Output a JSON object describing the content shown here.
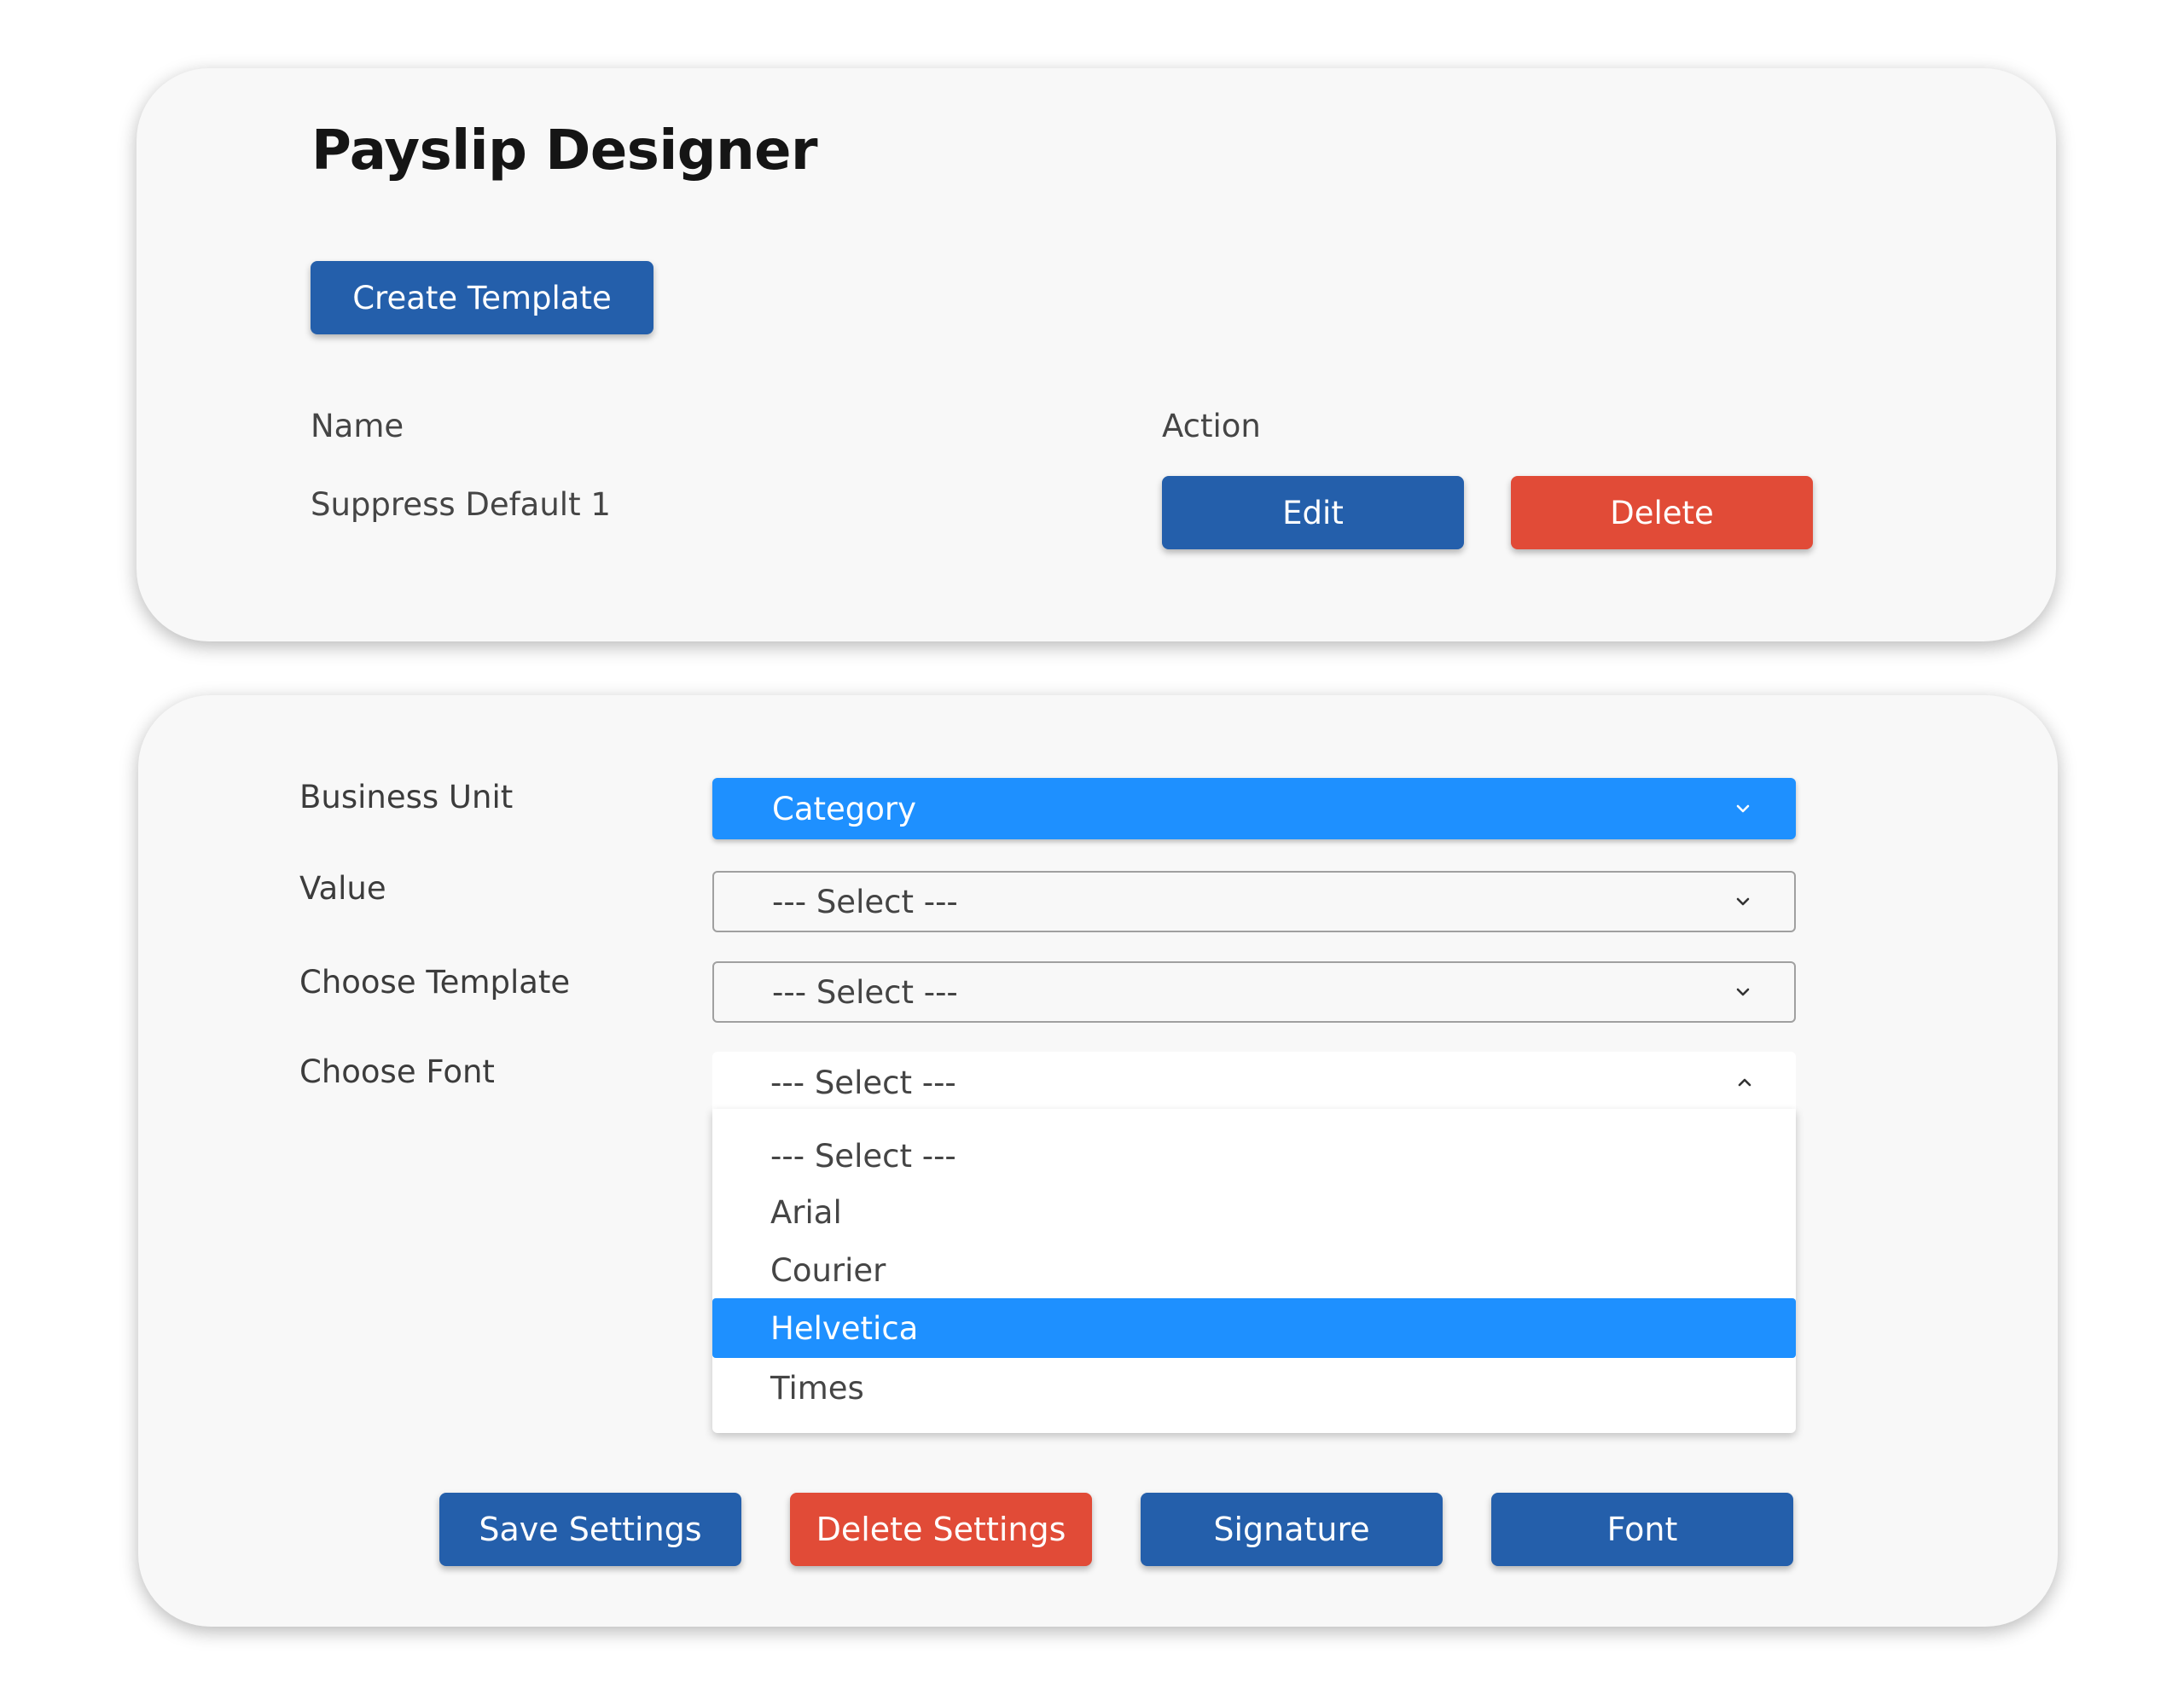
{
  "header": {
    "title": "Payslip Designer",
    "create_button": "Create Template"
  },
  "table": {
    "columns": [
      "Name",
      "Action"
    ],
    "rows": [
      {
        "name": "Suppress Default 1",
        "edit_label": "Edit",
        "delete_label": "Delete"
      }
    ]
  },
  "form": {
    "business_unit": {
      "label": "Business Unit",
      "value": "Category"
    },
    "value": {
      "label": "Value",
      "value": "--- Select ---"
    },
    "choose_template": {
      "label": "Choose Template",
      "value": "--- Select ---"
    },
    "choose_font": {
      "label": "Choose Font",
      "value": "--- Select ---",
      "options": [
        "--- Select ---",
        "Arial",
        "Courier",
        "Helvetica",
        "Times"
      ],
      "highlighted": "Helvetica"
    }
  },
  "actions": {
    "save": "Save Settings",
    "delete": "Delete Settings",
    "signature": "Signature",
    "font": "Font"
  },
  "colors": {
    "primary": "#245fab",
    "danger": "#e14b37",
    "highlight": "#1e90ff",
    "card": "#f8f8f8"
  },
  "icons": {
    "chevron_down": "chevron-down-icon",
    "chevron_up": "chevron-up-icon"
  }
}
